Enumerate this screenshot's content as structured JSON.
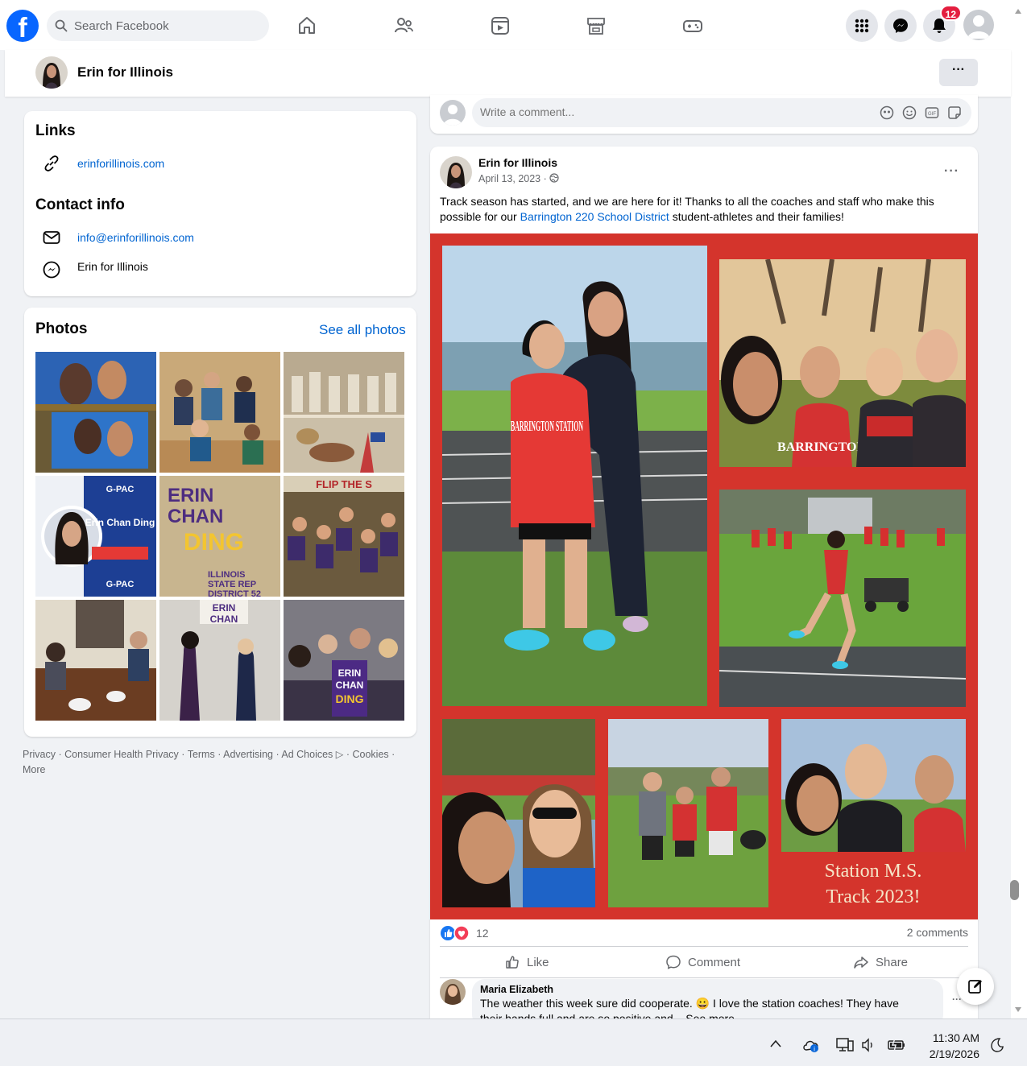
{
  "topbar": {
    "logo": "f",
    "search_placeholder": "Search Facebook",
    "notification_count": "12",
    "nav_icons": [
      "home-icon",
      "friends-icon",
      "video-icon",
      "marketplace-icon",
      "gaming-icon"
    ],
    "right_icons": [
      "menu-grid-icon",
      "messenger-icon",
      "bell-icon",
      "account-icon"
    ]
  },
  "page_header": {
    "name": "Erin for Illinois",
    "more_label": "···"
  },
  "links_card": {
    "links_title": "Links",
    "website": "erinforillinois.com",
    "contact_title": "Contact info",
    "email": "info@erinforillinois.com",
    "messenger": "Erin for Illinois"
  },
  "photos_card": {
    "title": "Photos",
    "see_all": "See all photos",
    "photo_texts": {
      "gpac_top": "G-PAC",
      "gpac_name": "Erin Chan Ding",
      "gpac_bottom": "G-PAC",
      "sign_line1": "ERIN",
      "sign_line2": "CHAN",
      "sign_line3": "DING",
      "sign_sub1": "ILLINOIS",
      "sign_sub2": "STATE REP",
      "sign_sub3": "DISTRICT 52",
      "flip_text": "FLIP THE S"
    }
  },
  "footer": {
    "line1": "Privacy · Consumer Health Privacy · Terms · Advertising · Ad Choices ▷ · Cookies ·",
    "line2": "More"
  },
  "comment_box": {
    "placeholder": "Write a comment..."
  },
  "post": {
    "author": "Erin for Illinois",
    "date": "April 13, 2023 · ",
    "text_before": "Track season has started, and we are here for it! Thanks to all the coaches and staff who make this possible for our ",
    "link_text": "Barrington 220 School District",
    "text_after": " student-athletes and their families!",
    "jersey_text": "BARRINGTON STATION",
    "collage_caption_1": "Station M.S.",
    "collage_caption_2": "Track 2023!",
    "reaction_count": "12",
    "comments_count": "2 comments",
    "like_label": "Like",
    "comment_label": "Comment",
    "share_label": "Share",
    "top_comment": {
      "author": "Maria Elizabeth",
      "text": "The weather this week sure did cooperate. 😀 I love the station coaches! They have",
      "text_cont": "their hands full and are so positive and... See more"
    }
  },
  "taskbar": {
    "time": "11:30 AM",
    "date": "2/19/2026"
  },
  "colors": {
    "facebook_blue": "#0866ff",
    "link_blue": "#0064d1",
    "collage_red": "#d4342c",
    "badge_red": "#e41e3f"
  }
}
